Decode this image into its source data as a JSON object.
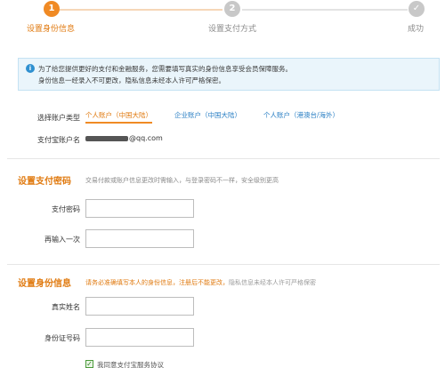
{
  "steps": [
    {
      "number": "1",
      "label": "设置身份信息",
      "state": "active"
    },
    {
      "number": "2",
      "label": "设置支付方式",
      "state": "pending"
    },
    {
      "icon": "check-icon",
      "label": "成功",
      "state": "pending"
    }
  ],
  "notice": {
    "icon": "info-icon",
    "line1": "为了给您提供更好的支付和金融服务，您需要填写真实的身份信息享受会员保障服务。",
    "line2": "身份信息一经录入不可更改，隐私信息未经本人许可严格保密。"
  },
  "account_type": {
    "label": "选择账户类型",
    "options": [
      "个人账户（中国大陆）",
      "企业账户（中国大陆）",
      "个人账户（港澳台/海外）"
    ],
    "selected": "个人账户（中国大陆）"
  },
  "account_name": {
    "label": "支付宝账户名",
    "value_suffix": "@qq.com"
  },
  "payment_password": {
    "title": "设置支付密码",
    "hint": "交易付款或账户信息更改时需输入，与登录密码不一样，安全级别更高",
    "password_label": "支付密码",
    "confirm_label": "再输入一次",
    "password_value": "",
    "confirm_value": ""
  },
  "identity": {
    "title": "设置身份信息",
    "hint_emphasis": "请务必准确填写本人的身份信息，注册后不能更改，",
    "hint_rest": "隐私信息未经本人许可严格保密",
    "name_label": "真实姓名",
    "id_label": "身份证号码",
    "name_value": "",
    "id_value": ""
  },
  "agreement": {
    "checked": true,
    "text": "我同意支付宝服务协议"
  },
  "colors": {
    "accent": "#f08a24",
    "link": "#2a7fc4",
    "notice_bg": "#eaf5fb"
  }
}
